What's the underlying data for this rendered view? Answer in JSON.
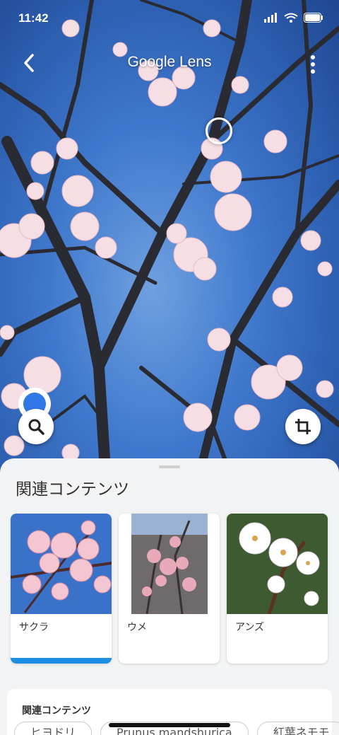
{
  "status": {
    "time": "11:42"
  },
  "appbar": {
    "title": "Google Lens"
  },
  "sheet": {
    "title": "関連コンテンツ",
    "cards": [
      {
        "label": "サクラ",
        "selected": true
      },
      {
        "label": "ウメ",
        "selected": false
      },
      {
        "label": "アンズ",
        "selected": false
      }
    ],
    "section_title": "関連コンテンツ",
    "chips": [
      "ヒヨドリ",
      "Prunus mandshurica",
      "紅葉ネモモ"
    ]
  },
  "icons": {
    "back": "back-arrow-icon",
    "more": "more-vert-icon",
    "search": "search-icon",
    "crop": "crop-icon"
  },
  "colors": {
    "accent": "#1a8fe3",
    "dot": "#2f78e6"
  }
}
